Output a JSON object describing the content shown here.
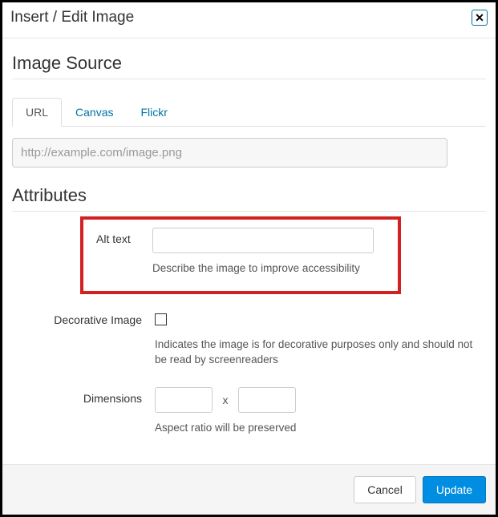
{
  "dialog": {
    "title": "Insert / Edit Image"
  },
  "source": {
    "heading": "Image Source",
    "tabs": {
      "url": "URL",
      "canvas": "Canvas",
      "flickr": "Flickr"
    },
    "url_placeholder": "http://example.com/image.png",
    "url_value": ""
  },
  "attributes": {
    "heading": "Attributes",
    "alt": {
      "label": "Alt text",
      "value": "",
      "hint": "Describe the image to improve accessibility"
    },
    "decorative": {
      "label": "Decorative Image",
      "checked": false,
      "hint": "Indicates the image is for decorative purposes only and should not be read by screenreaders"
    },
    "dimensions": {
      "label": "Dimensions",
      "width": "",
      "height": "",
      "separator": "x",
      "hint": "Aspect ratio will be preserved"
    }
  },
  "buttons": {
    "cancel": "Cancel",
    "update": "Update"
  }
}
